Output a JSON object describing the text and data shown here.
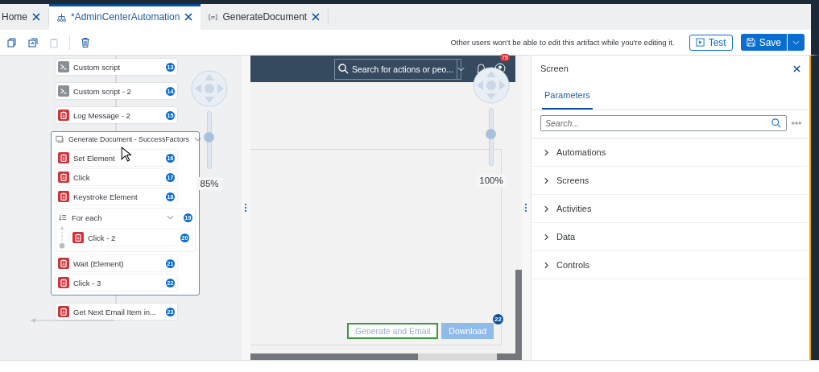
{
  "tabs": [
    {
      "label": "Home",
      "kind": "plain",
      "selected": false
    },
    {
      "label": "*AdminCenterAutomation",
      "kind": "flow",
      "selected": true
    },
    {
      "label": "GenerateDocument",
      "kind": "screen",
      "selected": false
    }
  ],
  "toolbar": {
    "tools": [
      {
        "kind": "copy",
        "disabled": false
      },
      {
        "kind": "paste-in",
        "disabled": false
      },
      {
        "kind": "paste",
        "disabled": true
      },
      {
        "kind": "delete",
        "disabled": false
      }
    ],
    "notice": "Other users won't be able to edit this artifact while you're editing it.",
    "test_label": "Test",
    "save_label": "Save"
  },
  "canvas": {
    "steps": [
      {
        "kind": "script",
        "label": "Custom script",
        "number": "13"
      },
      {
        "kind": "script",
        "label": "Custom script - 2",
        "number": "14"
      },
      {
        "kind": "activity",
        "label": "Log Message - 2",
        "number": "15"
      },
      {
        "kind": "group",
        "label": "Generate Document - SuccessFactors",
        "expanded": true,
        "children": [
          {
            "kind": "activity",
            "label": "Set Element",
            "number": "16"
          },
          {
            "kind": "activity",
            "label": "Click",
            "number": "17"
          },
          {
            "kind": "activity",
            "label": "Keystroke Element",
            "number": "18"
          },
          {
            "kind": "loop",
            "label": "For each",
            "number": "19",
            "expanded": true,
            "children": [
              {
                "kind": "activity",
                "label": "Click - 2",
                "number": "20"
              }
            ]
          },
          {
            "kind": "activity",
            "label": "Wait (Element)",
            "number": "21"
          },
          {
            "kind": "activity",
            "label": "Click - 3",
            "number": "22"
          }
        ]
      },
      {
        "kind": "activity",
        "label": "Get Next Email Item in...",
        "number": "23"
      }
    ],
    "zoom": {
      "level": 0.55,
      "reading": "85%"
    }
  },
  "preview": {
    "search_placeholder": "Search for actions or peo...",
    "notification_count": "75",
    "zoom": {
      "level": 0.55,
      "reading": "100%"
    },
    "buttons": [
      {
        "label": "Generate and Email",
        "selected": true
      },
      {
        "label": "Download",
        "selected": false
      }
    ],
    "step_badge": "22"
  },
  "panel": {
    "title": "Screen",
    "tabs": [
      {
        "label": "Parameters",
        "selected": true
      }
    ],
    "search_placeholder": "Search...",
    "sections": [
      {
        "label": "Automations",
        "expanded": false
      },
      {
        "label": "Screens",
        "expanded": false
      },
      {
        "label": "Activities",
        "expanded": false
      },
      {
        "label": "Data",
        "expanded": false
      },
      {
        "label": "Controls",
        "expanded": false
      }
    ]
  }
}
